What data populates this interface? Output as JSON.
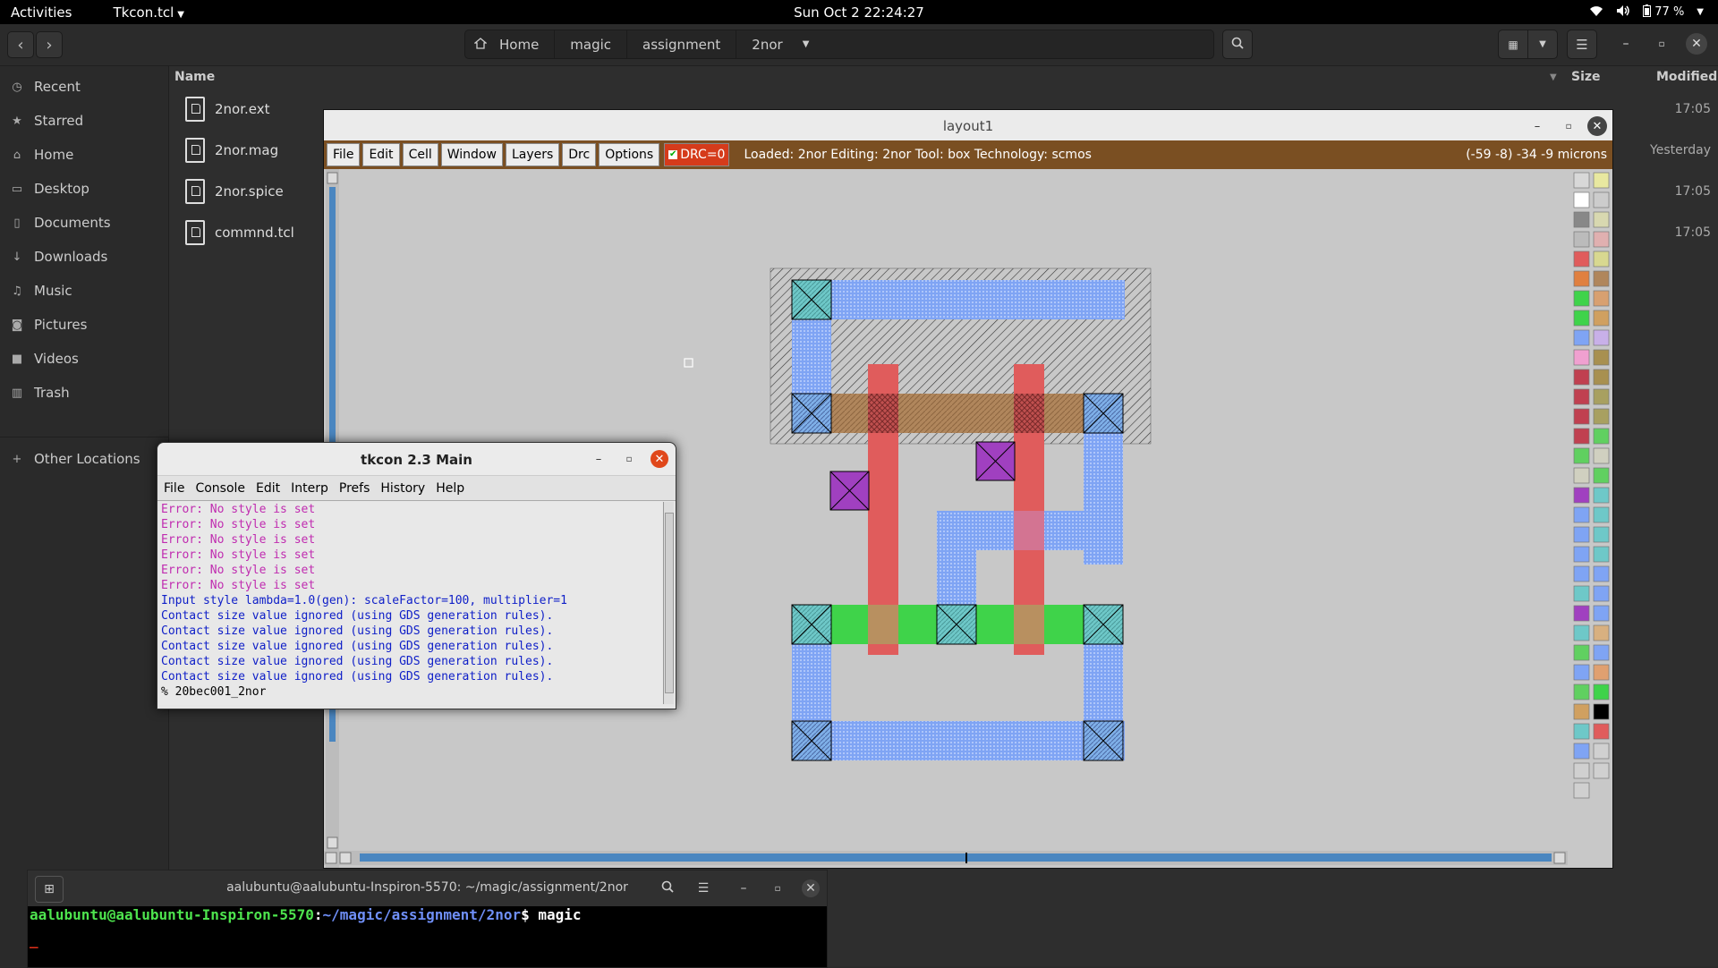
{
  "topbar": {
    "activities": "Activities",
    "app_name": "Tkcon.tcl",
    "clock": "Sun Oct 2  22:24:27",
    "battery": "77 %"
  },
  "files": {
    "path": [
      "Home",
      "magic",
      "assignment",
      "2nor"
    ],
    "sidebar": [
      {
        "label": "Recent",
        "icon": "clock-icon"
      },
      {
        "label": "Starred",
        "icon": "star-icon"
      },
      {
        "label": "Home",
        "icon": "home-icon"
      },
      {
        "label": "Desktop",
        "icon": "folder-icon"
      },
      {
        "label": "Documents",
        "icon": "document-icon"
      },
      {
        "label": "Downloads",
        "icon": "download-icon"
      },
      {
        "label": "Music",
        "icon": "music-icon"
      },
      {
        "label": "Pictures",
        "icon": "camera-icon"
      },
      {
        "label": "Videos",
        "icon": "video-icon"
      },
      {
        "label": "Trash",
        "icon": "trash-icon"
      },
      {
        "label": "Other Locations",
        "icon": "plus-icon"
      }
    ],
    "columns": {
      "name": "Name",
      "size": "Size",
      "modified": "Modified"
    },
    "rows": [
      {
        "name": "2nor.ext",
        "modified": "17:05"
      },
      {
        "name": "2nor.mag",
        "modified": "Yesterday"
      },
      {
        "name": "2nor.spice",
        "modified": "17:05"
      },
      {
        "name": "commnd.tcl",
        "modified": "17:05"
      }
    ]
  },
  "layout1": {
    "title": "layout1",
    "menu": [
      "File",
      "Edit",
      "Cell",
      "Window",
      "Layers",
      "Drc",
      "Options"
    ],
    "drc": "DRC=0",
    "status": "Loaded: 2nor Editing: 2nor Tool: box  Technology: scmos",
    "coords": "(-59 -8) -34 -9 microns",
    "colors": {
      "metal1": "#7fa4f4",
      "poly": "#e05c5c",
      "ndiff": "#3fd34a",
      "pdiff": "#b0865c",
      "nwell": "#555555",
      "contact": "#6ec8c8",
      "m2contact": "#a040c0",
      "background": "#c8c8c8",
      "menubar": "#7a4f22"
    }
  },
  "tkcon": {
    "title": "tkcon 2.3 Main",
    "menu": [
      "File",
      "Console",
      "Edit",
      "Interp",
      "Prefs",
      "History",
      "Help"
    ],
    "lines": [
      {
        "text": "Error: No style is set",
        "color": "#c02cb0"
      },
      {
        "text": "Error: No style is set",
        "color": "#c02cb0"
      },
      {
        "text": "Error: No style is set",
        "color": "#c02cb0"
      },
      {
        "text": "Error: No style is set",
        "color": "#c02cb0"
      },
      {
        "text": "Error: No style is set",
        "color": "#c02cb0"
      },
      {
        "text": "Error: No style is set",
        "color": "#c02cb0"
      },
      {
        "text": "Input style lambda=1.0(gen): scaleFactor=100, multiplier=1",
        "color": "#1020c8"
      },
      {
        "text": "Contact size value ignored (using GDS generation rules).",
        "color": "#1020c8"
      },
      {
        "text": "Contact size value ignored (using GDS generation rules).",
        "color": "#1020c8"
      },
      {
        "text": "Contact size value ignored (using GDS generation rules).",
        "color": "#1020c8"
      },
      {
        "text": "Contact size value ignored (using GDS generation rules).",
        "color": "#1020c8"
      },
      {
        "text": "Contact size value ignored (using GDS generation rules).",
        "color": "#1020c8"
      }
    ],
    "prompt": "% 20bec001_2nor"
  },
  "terminal": {
    "title": "aalubuntu@aalubuntu-Inspiron-5570: ~/magic/assignment/2nor",
    "user_host": "aalubuntu@aalubuntu-Inspiron-5570",
    "path": "~/magic/assignment/2nor",
    "command": "magic"
  }
}
